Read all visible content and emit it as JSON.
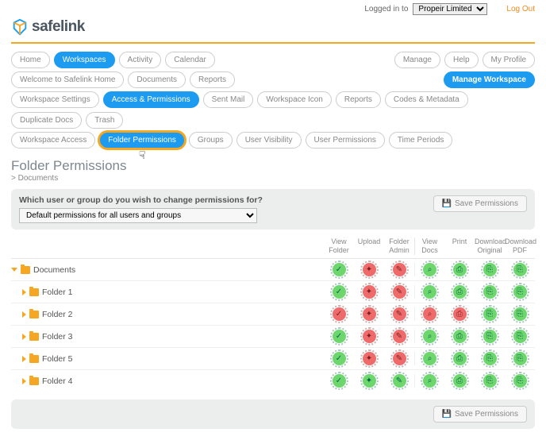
{
  "topbar": {
    "logged_in_label": "Logged in to",
    "org_selected": "Propeir Limited",
    "logout": "Log Out"
  },
  "logo": {
    "name": "safelink"
  },
  "nav_primary": {
    "left": [
      {
        "label": "Home",
        "active": false
      },
      {
        "label": "Workspaces",
        "active": true
      },
      {
        "label": "Activity",
        "active": false
      },
      {
        "label": "Calendar",
        "active": false
      }
    ],
    "right": [
      {
        "label": "Manage"
      },
      {
        "label": "Help"
      },
      {
        "label": "My Profile"
      }
    ]
  },
  "nav_secondary": {
    "left": [
      {
        "label": "Welcome to Safelink Home"
      },
      {
        "label": "Documents"
      },
      {
        "label": "Reports"
      }
    ],
    "right_primary": "Manage Workspace"
  },
  "nav_tertiary": [
    {
      "label": "Workspace Settings"
    },
    {
      "label": "Access & Permissions",
      "active": true
    },
    {
      "label": "Sent Mail"
    },
    {
      "label": "Workspace Icon"
    },
    {
      "label": "Reports"
    },
    {
      "label": "Codes & Metadata"
    },
    {
      "label": "Duplicate Docs"
    },
    {
      "label": "Trash"
    }
  ],
  "nav_quaternary": [
    {
      "label": "Workspace Access"
    },
    {
      "label": "Folder Permissions",
      "active": true,
      "focused": true
    },
    {
      "label": "Groups"
    },
    {
      "label": "User Visibility"
    },
    {
      "label": "User Permissions"
    },
    {
      "label": "Time Periods"
    }
  ],
  "page_title": "Folder Permissions",
  "breadcrumb": "> Documents",
  "prompt": "Which user or group do you wish to change permissions for?",
  "dropdown_value": "Default permissions for all users and groups",
  "save_label": "Save Permissions",
  "columns": [
    {
      "l1": "View",
      "l2": "Folder"
    },
    {
      "l1": "Upload",
      "l2": ""
    },
    {
      "l1": "Folder",
      "l2": "Admin"
    },
    {
      "l1": "View",
      "l2": "Docs",
      "sep": true
    },
    {
      "l1": "Print",
      "l2": ""
    },
    {
      "l1": "Download",
      "l2": "Original"
    },
    {
      "l1": "Download",
      "l2": "PDF"
    }
  ],
  "rows": [
    {
      "name": "Documents",
      "indent": 0,
      "expanded": true,
      "perms": [
        {
          "c": "g",
          "g": "✓"
        },
        {
          "c": "r",
          "g": "✦"
        },
        {
          "c": "r",
          "g": "✎"
        },
        {
          "c": "g",
          "g": "⌕"
        },
        {
          "c": "g",
          "g": "⎙"
        },
        {
          "c": "g",
          "g": "⎘"
        },
        {
          "c": "g",
          "g": "⎘"
        }
      ]
    },
    {
      "name": "Folder 1",
      "indent": 1,
      "expanded": false,
      "perms": [
        {
          "c": "g",
          "g": "✓"
        },
        {
          "c": "r",
          "g": "✦"
        },
        {
          "c": "r",
          "g": "✎"
        },
        {
          "c": "g",
          "g": "⌕"
        },
        {
          "c": "g",
          "g": "⎙"
        },
        {
          "c": "g",
          "g": "⎘"
        },
        {
          "c": "g",
          "g": "⎘"
        }
      ]
    },
    {
      "name": "Folder 2",
      "indent": 1,
      "expanded": false,
      "perms": [
        {
          "c": "r",
          "g": "✓"
        },
        {
          "c": "r",
          "g": "✦"
        },
        {
          "c": "r",
          "g": "✎"
        },
        {
          "c": "r",
          "g": "⌕"
        },
        {
          "c": "r",
          "g": "⎙"
        },
        {
          "c": "g",
          "g": "⎘"
        },
        {
          "c": "g",
          "g": "⎘"
        }
      ]
    },
    {
      "name": "Folder 3",
      "indent": 1,
      "expanded": false,
      "perms": [
        {
          "c": "g",
          "g": "✓"
        },
        {
          "c": "r",
          "g": "✦"
        },
        {
          "c": "r",
          "g": "✎"
        },
        {
          "c": "g",
          "g": "⌕"
        },
        {
          "c": "g",
          "g": "⎙"
        },
        {
          "c": "g",
          "g": "⎘"
        },
        {
          "c": "g",
          "g": "⎘"
        }
      ]
    },
    {
      "name": "Folder 5",
      "indent": 1,
      "expanded": false,
      "perms": [
        {
          "c": "g",
          "g": "✓"
        },
        {
          "c": "r",
          "g": "✦"
        },
        {
          "c": "r",
          "g": "✎"
        },
        {
          "c": "g",
          "g": "⌕"
        },
        {
          "c": "g",
          "g": "⎙"
        },
        {
          "c": "g",
          "g": "⎘"
        },
        {
          "c": "g",
          "g": "⎘"
        }
      ]
    },
    {
      "name": "Folder 4",
      "indent": 1,
      "expanded": false,
      "perms": [
        {
          "c": "g",
          "g": "✓"
        },
        {
          "c": "g",
          "g": "✦"
        },
        {
          "c": "g",
          "g": "✎"
        },
        {
          "c": "g",
          "g": "⌕"
        },
        {
          "c": "g",
          "g": "⎙"
        },
        {
          "c": "g",
          "g": "⎘"
        },
        {
          "c": "g",
          "g": "⎘"
        }
      ]
    }
  ]
}
